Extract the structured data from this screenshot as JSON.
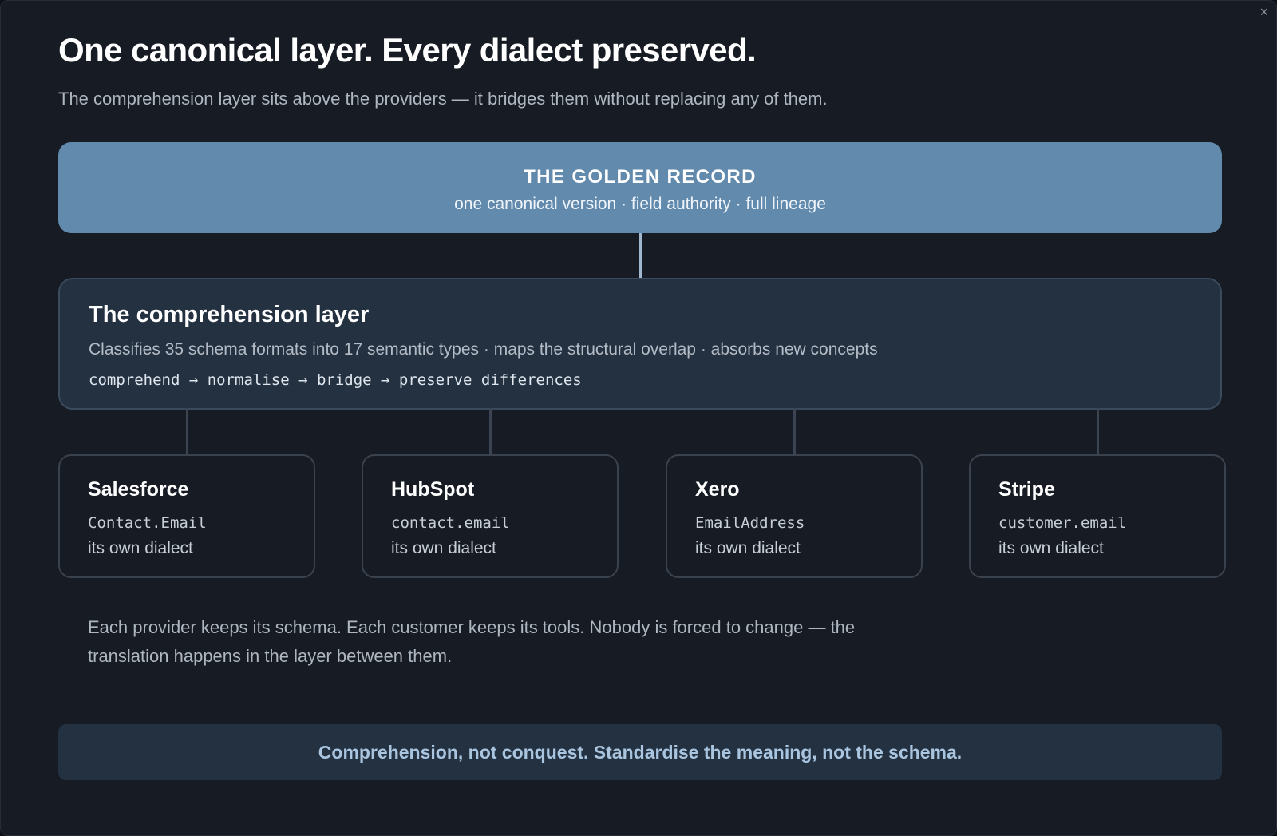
{
  "window": {
    "close_glyph": "×"
  },
  "header": {
    "title": "One canonical layer. Every dialect preserved.",
    "subtitle": "The comprehension layer sits above the providers — it bridges them without replacing any of them."
  },
  "golden_record": {
    "title": "THE GOLDEN RECORD",
    "subtitle": "one canonical version · field authority · full lineage"
  },
  "comprehension_layer": {
    "title": "The comprehension layer",
    "description": "Classifies 35 schema formats into 17 semantic types · maps the structural overlap · absorbs new concepts",
    "flow": "comprehend → normalise → bridge → preserve differences"
  },
  "providers": [
    {
      "name": "Salesforce",
      "field": "Contact.Email",
      "note": "its own dialect"
    },
    {
      "name": "HubSpot",
      "field": "contact.email",
      "note": "its own dialect"
    },
    {
      "name": "Xero",
      "field": "EmailAddress",
      "note": "its own dialect"
    },
    {
      "name": "Stripe",
      "field": "customer.email",
      "note": "its own dialect"
    }
  ],
  "note": "Each provider keeps its schema. Each customer keeps its tools. Nobody is forced to change — the translation happens in the layer between them.",
  "banner": "Comprehension, not conquest. Standardise the meaning, not the schema.",
  "colors": {
    "background": "#171c24",
    "golden_record_fill": "#628aad",
    "layer_fill": "#243141",
    "banner_text": "#a9c5df"
  }
}
